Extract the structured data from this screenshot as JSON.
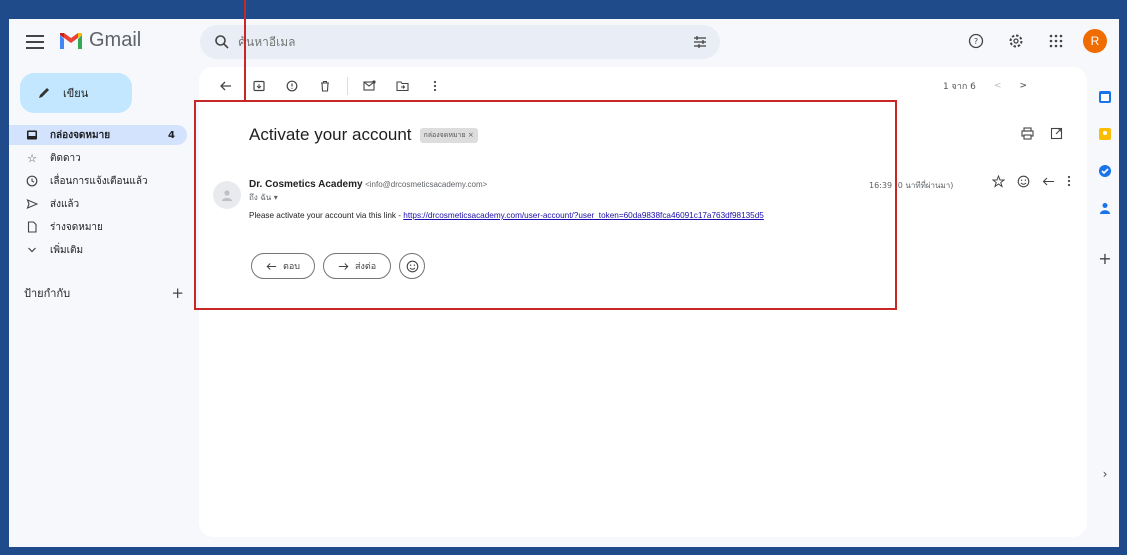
{
  "app": {
    "name": "Gmail"
  },
  "search": {
    "placeholder": "ค้นหาอีเมล"
  },
  "account": {
    "initial": "R"
  },
  "compose": {
    "label": "เขียน"
  },
  "nav": {
    "items": [
      {
        "label": "กล่องจดหมาย",
        "count": "4",
        "icon": "inbox-icon",
        "active": true
      },
      {
        "label": "ติดดาว",
        "icon": "star-icon"
      },
      {
        "label": "เลื่อนการแจ้งเตือนแล้ว",
        "icon": "clock-icon"
      },
      {
        "label": "ส่งแล้ว",
        "icon": "send-icon"
      },
      {
        "label": "ร่างจดหมาย",
        "icon": "draft-icon"
      },
      {
        "label": "เพิ่มเติม",
        "icon": "chevron-down-icon"
      }
    ],
    "labels_heading": "ป้ายกำกับ"
  },
  "pager": {
    "text": "1 จาก 6"
  },
  "email": {
    "subject": "Activate your account",
    "tag": "กล่องจดหมาย ×",
    "sender_name": "Dr. Cosmetics Academy",
    "sender_email": "<info@drcosmeticsacademy.com>",
    "to": "ถึง ฉัน ▾",
    "time": "16:39 (0 นาทีที่ผ่านมา)",
    "body_prefix": "Please activate your account via this link - ",
    "link": "https://drcosmeticsacademy.com/user-account/?user_token=60da9838fca46091c17a763df98135d5"
  },
  "actions": {
    "reply": "ตอบ",
    "forward": "ส่งต่อ"
  },
  "colors": {
    "highlight": "#c62828",
    "frame": "#1f4b8a",
    "compose_bg": "#c2e7ff",
    "active_nav": "#d3e3fd",
    "avatar": "#ef6c00"
  }
}
